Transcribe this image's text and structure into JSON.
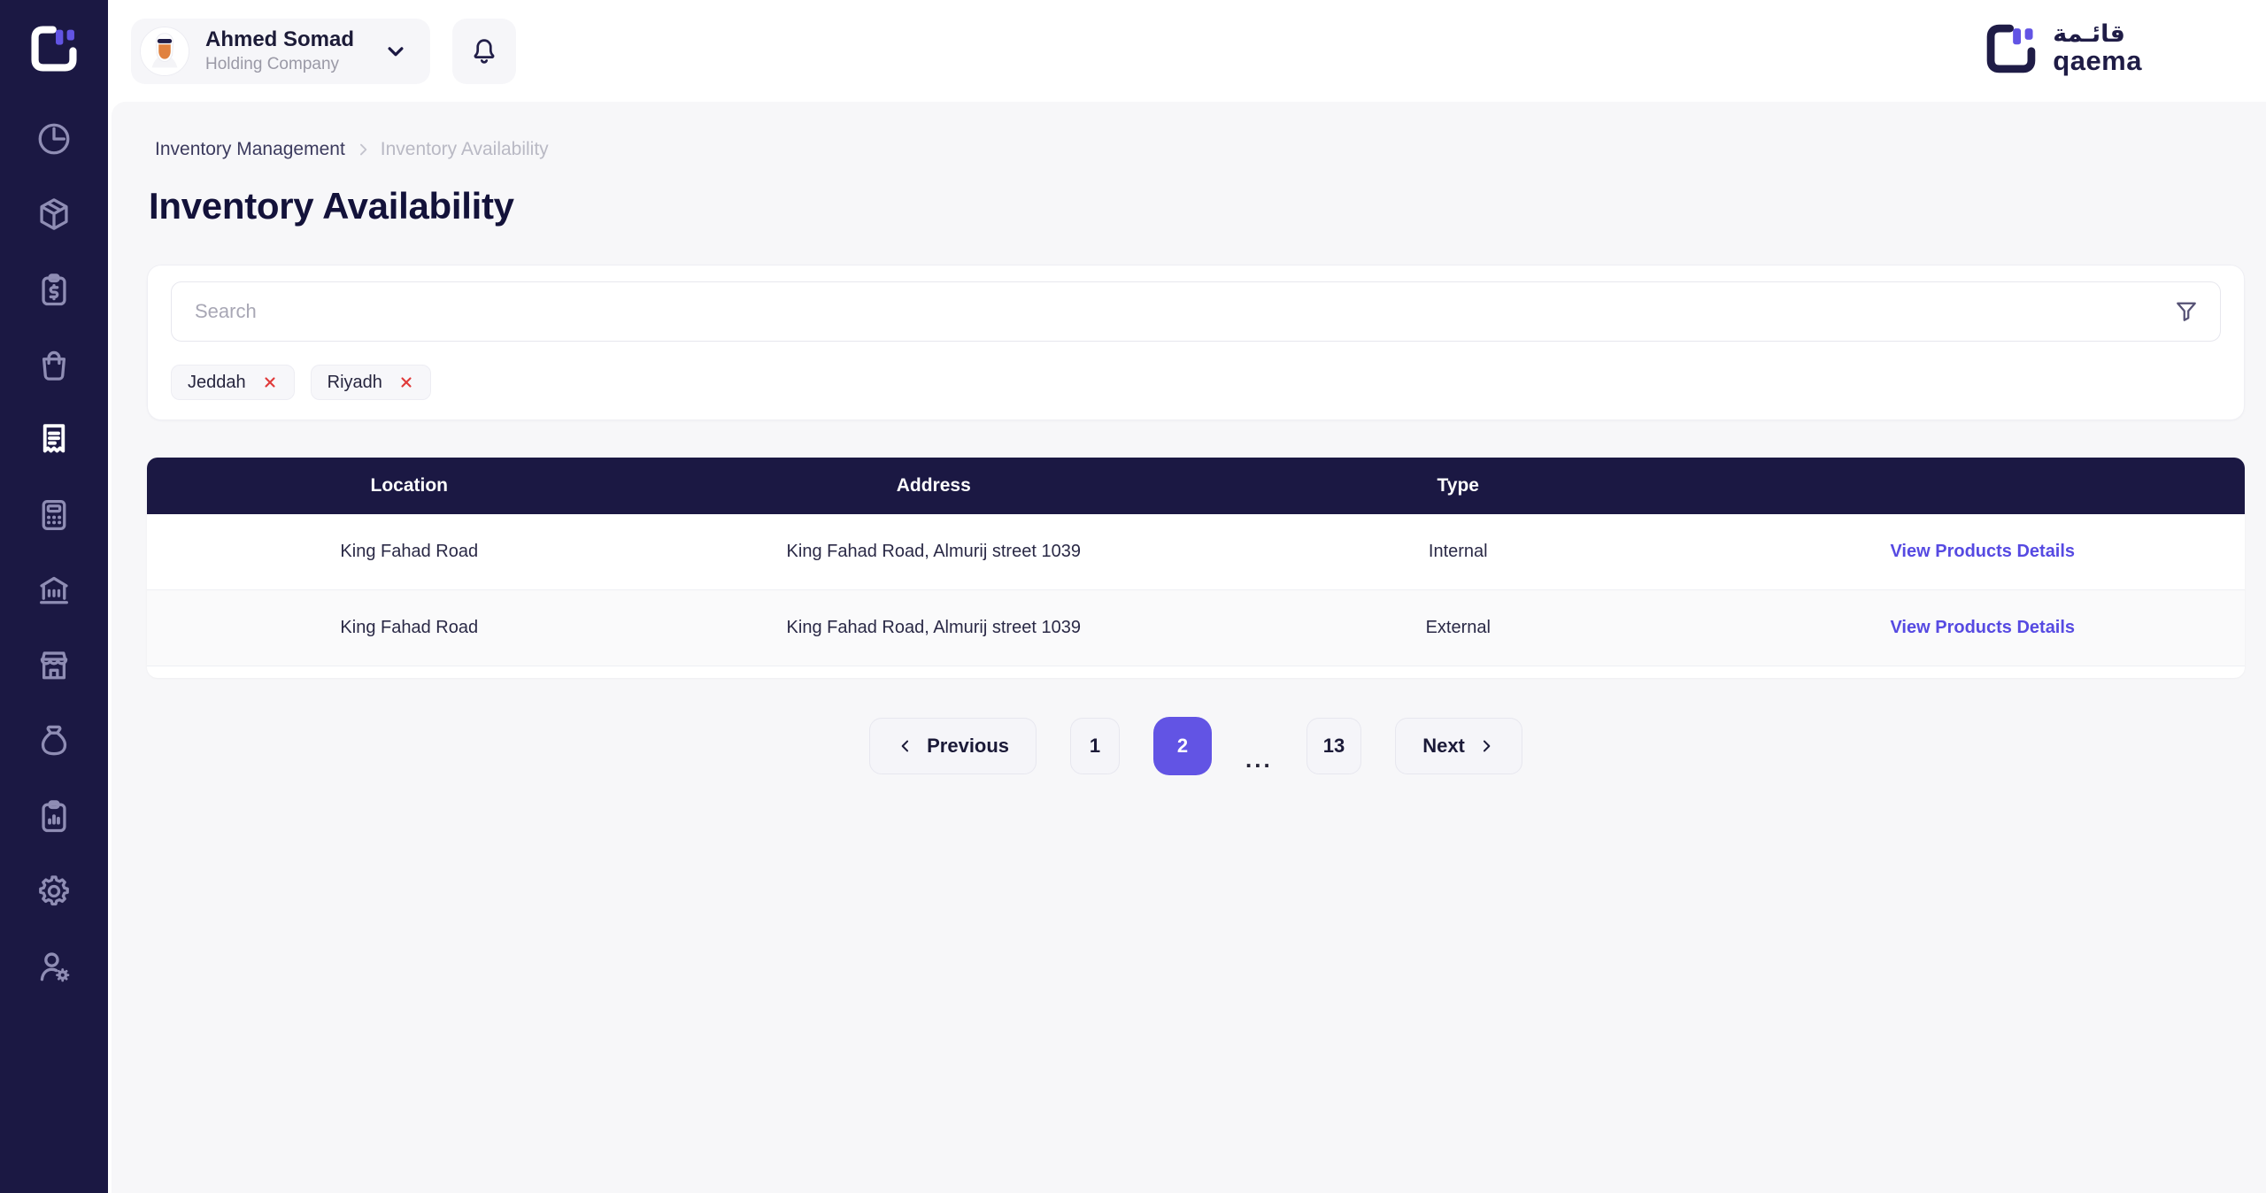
{
  "app": {
    "name": "qaema"
  },
  "colors": {
    "navy": "#1b1843",
    "accent_purple": "#6254e4",
    "link_purple": "#564ae2",
    "danger_red": "#e03a3a",
    "page_bg": "#f7f7f9",
    "sidebar_icon": "#8f8db4"
  },
  "topbar": {
    "user": {
      "name": "Ahmed Somad",
      "role": "Holding Company"
    },
    "icons": [
      "avatar",
      "chevron-down-icon",
      "bell-icon"
    ]
  },
  "logo": {
    "arabic": "قائـمة",
    "latin": "qaema"
  },
  "sidebar": {
    "items": [
      {
        "icon": "clock-icon",
        "active": false
      },
      {
        "icon": "package-icon",
        "active": false
      },
      {
        "icon": "clipboard-dollar-icon",
        "active": false
      },
      {
        "icon": "shopping-bag-icon",
        "active": false
      },
      {
        "icon": "receipt-icon",
        "active": true
      },
      {
        "icon": "calculator-icon",
        "active": false
      },
      {
        "icon": "bank-icon",
        "active": false
      },
      {
        "icon": "store-icon",
        "active": false
      },
      {
        "icon": "money-bag-icon",
        "active": false
      },
      {
        "icon": "clipboard-chart-icon",
        "active": false
      },
      {
        "icon": "gear-icon",
        "active": false
      },
      {
        "icon": "user-gear-icon",
        "active": false
      }
    ]
  },
  "breadcrumb": {
    "items": [
      {
        "label": "Inventory Management",
        "muted": false
      },
      {
        "label": "Inventory Availability",
        "muted": true
      }
    ]
  },
  "page": {
    "title": "Inventory Availability"
  },
  "search": {
    "placeholder": "Search",
    "value": "",
    "filter_icon": "funnel-icon"
  },
  "filters": {
    "chips": [
      {
        "label": "Jeddah",
        "remove_icon": "close-x-icon"
      },
      {
        "label": "Riyadh",
        "remove_icon": "close-x-icon"
      }
    ]
  },
  "table": {
    "columns": [
      "Location",
      "Address",
      "Type",
      ""
    ],
    "rows": [
      {
        "location": "King Fahad Road",
        "address": "King Fahad Road, Almurij street 1039",
        "type": "Internal",
        "action": "View Products Details"
      },
      {
        "location": "King Fahad Road",
        "address": "King Fahad Road, Almurij street 1039",
        "type": "External",
        "action": "View Products Details"
      }
    ]
  },
  "pagination": {
    "previous": "Previous",
    "next": "Next",
    "pages": [
      "1",
      "2",
      "13"
    ],
    "active_page": "2",
    "ellipsis": "..."
  }
}
